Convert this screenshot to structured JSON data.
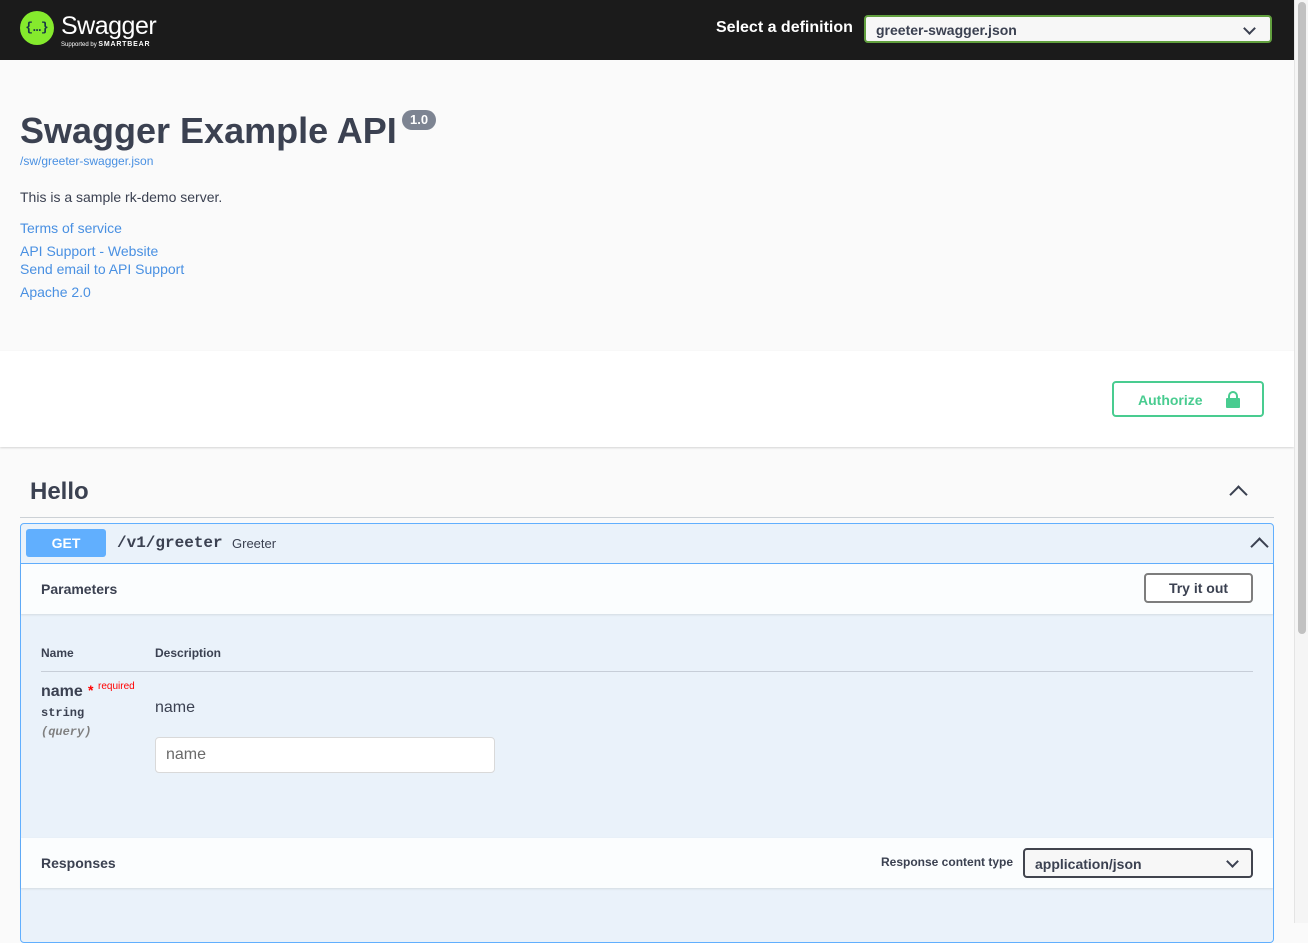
{
  "topbar": {
    "logo_mark": "{…}",
    "logo_name": "Swagger",
    "logo_sub_prefix": "Supported by",
    "logo_sub_brand": "SMARTBEAR",
    "definition_label": "Select a definition",
    "definition_value": "greeter-swagger.json"
  },
  "info": {
    "title": "Swagger Example API",
    "version": "1.0",
    "spec_url": "/sw/greeter-swagger.json",
    "description": "This is a sample rk-demo server.",
    "links": {
      "terms": "Terms of service",
      "support_website": "API Support - Website",
      "support_email": "Send email to API Support",
      "license": "Apache 2.0"
    }
  },
  "scheme": {
    "authorize_label": "Authorize"
  },
  "tag": {
    "name": "Hello"
  },
  "operation": {
    "method": "GET",
    "path": "/v1/greeter",
    "summary": "Greeter",
    "parameters_title": "Parameters",
    "try_it_out_label": "Try it out",
    "columns": {
      "name": "Name",
      "description": "Description"
    },
    "parameter": {
      "name": "name",
      "required_star": "*",
      "required_label": "required",
      "type": "string",
      "location": "(query)",
      "description": "name",
      "input_value": "",
      "input_placeholder": "name"
    },
    "responses_title": "Responses",
    "content_type_label": "Response content type",
    "content_type_value": "application/json"
  },
  "colors": {
    "topbar_bg": "#1b1b1b",
    "logo_green": "#85ea2d",
    "authorize_green": "#49cc90",
    "get_blue": "#61affe",
    "required_red": "#ff0000",
    "link_blue": "#4990e2"
  }
}
